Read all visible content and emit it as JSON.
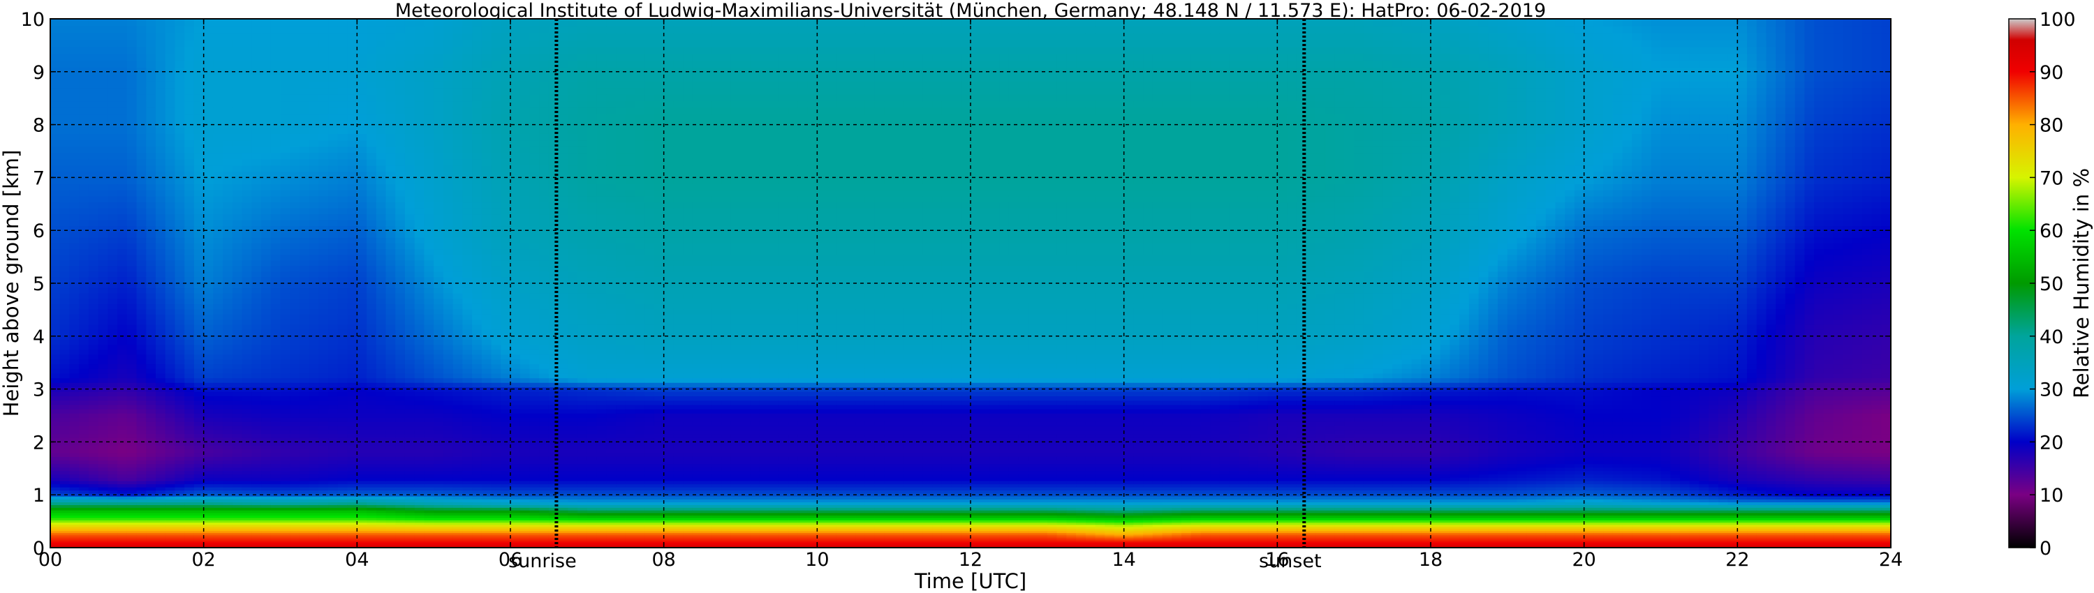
{
  "chart_data": {
    "type": "heatmap",
    "title": "Meteorological Institute of Ludwig-Maximilians-Universität (München, Germany; 48.148 N / 11.573 E):    HatPro: 06-02-2019",
    "xlabel": "Time [UTC]",
    "ylabel": "Height above ground [km]",
    "xlim": [
      0,
      24
    ],
    "ylim": [
      0,
      10
    ],
    "x_ticks": [
      0,
      2,
      4,
      6,
      8,
      10,
      12,
      14,
      16,
      18,
      20,
      22,
      24
    ],
    "x_tick_labels": [
      "00",
      "02",
      "04",
      "06",
      "08",
      "10",
      "12",
      "14",
      "16",
      "18",
      "20",
      "22",
      "24"
    ],
    "y_ticks": [
      0,
      1,
      2,
      3,
      4,
      5,
      6,
      7,
      8,
      9,
      10
    ],
    "y_tick_labels": [
      "0",
      "1",
      "2",
      "3",
      "4",
      "5",
      "6",
      "7",
      "8",
      "9",
      "10"
    ],
    "grid": true,
    "annotations": [
      {
        "label": "sunrise",
        "x": 6.6
      },
      {
        "label": "sunset",
        "x": 16.35
      }
    ],
    "colorbar": {
      "label": "Relative Humidity in %",
      "range": [
        0,
        100
      ],
      "ticks": [
        0,
        10,
        20,
        30,
        40,
        50,
        60,
        70,
        80,
        90,
        100
      ],
      "tick_labels": [
        "0",
        "10",
        "20",
        "30",
        "40",
        "50",
        "60",
        "70",
        "80",
        "90",
        "100"
      ],
      "colormap": [
        {
          "v": 0,
          "c": "#000000"
        },
        {
          "v": 10,
          "c": "#7a0083"
        },
        {
          "v": 20,
          "c": "#0000c8"
        },
        {
          "v": 30,
          "c": "#009fd8"
        },
        {
          "v": 40,
          "c": "#00a49c"
        },
        {
          "v": 50,
          "c": "#009a00"
        },
        {
          "v": 60,
          "c": "#00e200"
        },
        {
          "v": 70,
          "c": "#d6f400"
        },
        {
          "v": 80,
          "c": "#ffb000"
        },
        {
          "v": 90,
          "c": "#f00000"
        },
        {
          "v": 96,
          "c": "#d00000"
        },
        {
          "v": 100,
          "c": "#cccccc"
        }
      ]
    },
    "profile_heights_km": [
      0,
      0.1,
      0.25,
      0.4,
      0.55,
      0.7,
      0.85,
      1.0,
      1.3,
      1.8,
      2.5,
      3.0,
      3.2,
      4.0,
      5.0,
      6.0,
      7.0,
      8.0,
      9.0,
      10.0
    ],
    "times_h": [
      0,
      1,
      2,
      3,
      4,
      5,
      6,
      7,
      8,
      9,
      10,
      11,
      12,
      13,
      14,
      15,
      16,
      17,
      18,
      19,
      20,
      21,
      22,
      23,
      24
    ],
    "humidity": [
      [
        95,
        90,
        85,
        75,
        62,
        55,
        40,
        25,
        18,
        12,
        14,
        18,
        21,
        23,
        24,
        25,
        26,
        27,
        27,
        28
      ],
      [
        95,
        90,
        85,
        75,
        62,
        55,
        40,
        22,
        14,
        10,
        12,
        16,
        18,
        20,
        22,
        24,
        26,
        27,
        27,
        28
      ],
      [
        95,
        90,
        85,
        75,
        62,
        55,
        40,
        26,
        19,
        14,
        18,
        21,
        24,
        26,
        28,
        29,
        30,
        31,
        31,
        30
      ],
      [
        95,
        90,
        85,
        75,
        62,
        55,
        38,
        25,
        19,
        16,
        19,
        21,
        23,
        24,
        25,
        27,
        29,
        31,
        31,
        30
      ],
      [
        95,
        90,
        85,
        75,
        62,
        55,
        40,
        26,
        20,
        17,
        19,
        20,
        22,
        23,
        24,
        26,
        28,
        30,
        31,
        30
      ],
      [
        95,
        90,
        85,
        74,
        60,
        50,
        35,
        26,
        20,
        17,
        19,
        21,
        25,
        27,
        29,
        31,
        32,
        33,
        33,
        31
      ],
      [
        95,
        90,
        85,
        74,
        60,
        50,
        32,
        25,
        20,
        18,
        20,
        22,
        28,
        31,
        33,
        35,
        36,
        37,
        36,
        34
      ],
      [
        95,
        90,
        85,
        74,
        58,
        45,
        30,
        25,
        20,
        18,
        20,
        23,
        31,
        33,
        35,
        37,
        39,
        39,
        38,
        35
      ],
      [
        95,
        90,
        85,
        74,
        58,
        45,
        30,
        25,
        20,
        18,
        19,
        24,
        31,
        34,
        36,
        38,
        40,
        40,
        38,
        35
      ],
      [
        95,
        90,
        85,
        74,
        58,
        45,
        30,
        25,
        20,
        18,
        19,
        24,
        31,
        34,
        36,
        38,
        40,
        40,
        38,
        35
      ],
      [
        95,
        90,
        85,
        74,
        58,
        45,
        30,
        25,
        20,
        18,
        19,
        24,
        31,
        34,
        36,
        38,
        40,
        40,
        38,
        35
      ],
      [
        95,
        90,
        85,
        74,
        58,
        45,
        30,
        25,
        20,
        18,
        19,
        24,
        31,
        34,
        36,
        38,
        40,
        40,
        38,
        35
      ],
      [
        95,
        90,
        85,
        74,
        58,
        45,
        30,
        25,
        20,
        18,
        19,
        24,
        31,
        34,
        36,
        38,
        40,
        40,
        38,
        35
      ],
      [
        95,
        90,
        85,
        74,
        58,
        45,
        30,
        25,
        20,
        18,
        19,
        24,
        31,
        34,
        36,
        38,
        40,
        40,
        38,
        35
      ],
      [
        95,
        90,
        80,
        70,
        56,
        42,
        30,
        25,
        20,
        18,
        19,
        24,
        31,
        34,
        36,
        38,
        40,
        40,
        38,
        35
      ],
      [
        95,
        90,
        85,
        74,
        58,
        45,
        30,
        25,
        20,
        18,
        19,
        24,
        31,
        34,
        36,
        38,
        40,
        40,
        38,
        35
      ],
      [
        95,
        90,
        85,
        74,
        58,
        45,
        30,
        25,
        20,
        17,
        18,
        23,
        31,
        34,
        36,
        38,
        40,
        40,
        38,
        35
      ],
      [
        95,
        90,
        85,
        74,
        58,
        45,
        30,
        25,
        20,
        16,
        18,
        23,
        30,
        33,
        35,
        37,
        39,
        39,
        38,
        35
      ],
      [
        95,
        90,
        85,
        74,
        58,
        45,
        30,
        25,
        20,
        16,
        18,
        22,
        28,
        31,
        33,
        35,
        37,
        38,
        37,
        34
      ],
      [
        95,
        90,
        85,
        74,
        58,
        45,
        30,
        25,
        21,
        18,
        19,
        21,
        25,
        26,
        28,
        31,
        33,
        35,
        35,
        32
      ],
      [
        95,
        90,
        85,
        74,
        58,
        45,
        32,
        26,
        22,
        19,
        20,
        21,
        23,
        24,
        25,
        27,
        30,
        32,
        32,
        30
      ],
      [
        95,
        90,
        85,
        74,
        58,
        45,
        30,
        25,
        21,
        19,
        20,
        20,
        22,
        23,
        24,
        26,
        28,
        29,
        30,
        29
      ],
      [
        95,
        90,
        85,
        74,
        58,
        45,
        28,
        22,
        18,
        15,
        17,
        19,
        21,
        22,
        24,
        26,
        28,
        29,
        30,
        29
      ],
      [
        95,
        90,
        85,
        74,
        58,
        45,
        28,
        20,
        16,
        11,
        12,
        14,
        16,
        17,
        19,
        21,
        23,
        24,
        25,
        25
      ],
      [
        95,
        90,
        85,
        74,
        58,
        45,
        28,
        20,
        15,
        10,
        10,
        13,
        15,
        16,
        18,
        20,
        22,
        23,
        24,
        24
      ]
    ]
  }
}
